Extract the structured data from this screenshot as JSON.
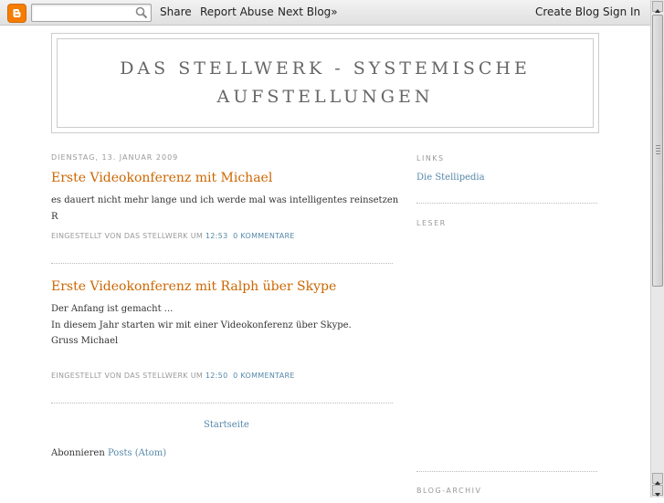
{
  "navbar": {
    "logo_icon": "blogger-logo-icon",
    "search_placeholder": "",
    "share": "Share",
    "report_abuse": "Report Abuse",
    "next_blog": "Next Blog»",
    "create_blog": "Create Blog",
    "sign_in": "Sign In"
  },
  "header": {
    "title_line1": "Das Stellwerk - Systemische",
    "title_line2": "Aufstellungen"
  },
  "main": {
    "date": "Dienstag, 13. Januar 2009",
    "posts": [
      {
        "title": "Erste Videokonferenz mit Michael",
        "body": [
          "es dauert nicht mehr lange und ich werde mal was intelligentes reinsetzen",
          "R"
        ],
        "footer_prefix": "Eingestellt von Das Stellwerk um",
        "time": "12:53",
        "comments": "0 Kommentare"
      },
      {
        "title": "Erste Videokonferenz mit Ralph über Skype",
        "body": [
          "Der Anfang ist gemacht ...",
          "In diesem Jahr starten wir mit einer Videokonferenz über Skype.",
          "Gruss Michael"
        ],
        "footer_prefix": "Eingestellt von Das Stellwerk um",
        "time": "12:50",
        "comments": "0 Kommentare"
      }
    ],
    "home_link": "Startseite",
    "subscribe_label": "Abonnieren",
    "subscribe_link": "Posts (Atom)"
  },
  "sidebar": {
    "links_heading": "Links",
    "links": [
      "Die Stellipedia"
    ],
    "readers_heading": "Leser",
    "archive_heading": "Blog-Archiv"
  },
  "colors": {
    "post_title": "#cc6600",
    "link": "#5588aa",
    "muted": "#999999"
  }
}
